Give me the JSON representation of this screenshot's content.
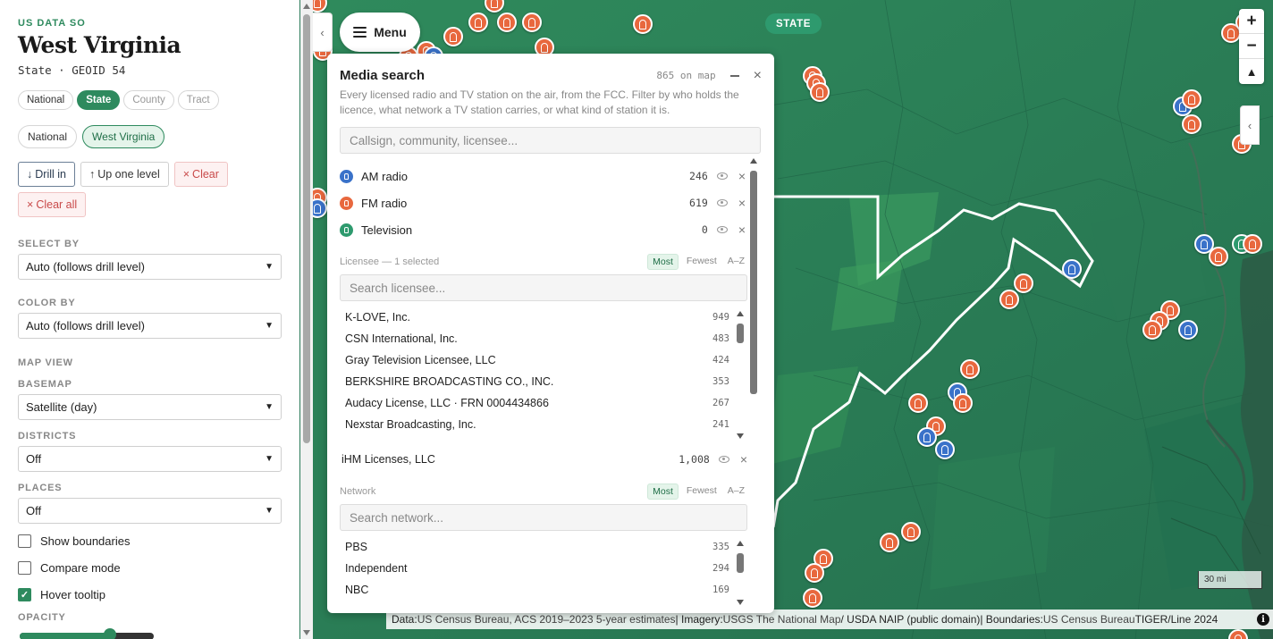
{
  "sidebar": {
    "eyebrow": "US DATA SO",
    "title": "West Virginia",
    "subtitle": "State · GEOID 54",
    "levels": [
      {
        "label": "National",
        "state": "normal"
      },
      {
        "label": "State",
        "state": "active"
      },
      {
        "label": "County",
        "state": "muted"
      },
      {
        "label": "Tract",
        "state": "muted"
      }
    ],
    "breadcrumb": [
      {
        "label": "National",
        "active": false
      },
      {
        "label": "West Virginia",
        "active": true
      }
    ],
    "actions": {
      "drill_in": "Drill in",
      "up_one_level": "Up one level",
      "clear": "Clear",
      "clear_all": "Clear all"
    },
    "select_by": {
      "label": "SELECT BY",
      "value": "Auto (follows drill level)"
    },
    "color_by": {
      "label": "COLOR BY",
      "value": "Auto (follows drill level)"
    },
    "map_view_label": "MAP VIEW",
    "basemap": {
      "label": "BASEMAP",
      "value": "Satellite (day)"
    },
    "districts": {
      "label": "DISTRICTS",
      "value": "Off"
    },
    "places": {
      "label": "PLACES",
      "value": "Off"
    },
    "checks": {
      "show_boundaries": {
        "label": "Show boundaries",
        "checked": false
      },
      "compare_mode": {
        "label": "Compare mode",
        "checked": false
      },
      "hover_tooltip": {
        "label": "Hover tooltip",
        "checked": true
      }
    },
    "opacity": {
      "label": "OPACITY",
      "value": 0.67
    }
  },
  "map": {
    "menu_label": "Menu",
    "level_badge": "STATE",
    "scale_label": "30 mi",
    "attribution": {
      "data_prefix": "Data: ",
      "data_source": "US Census Bureau, ACS 2019–2023 5-year estimates",
      "sep1": " | Imagery: ",
      "imagery_source": "USGS The National Map",
      "imagery_suffix": " / USDA NAIP (public domain)",
      "sep2": " | Boundaries: ",
      "boundaries_source": "US Census Bureau",
      "boundaries_suffix": " TIGER/Line 2024"
    },
    "colors": {
      "fm": "#e8683e",
      "am": "#3a72c9",
      "tv": "#2e9a6e",
      "state_outline": "#ffffff"
    }
  },
  "media_panel": {
    "title": "Media search",
    "count_text": "865 on map",
    "description": "Every licensed radio and TV station on the air, from the FCC. Filter by who holds the licence, what network a TV station carries, or what kind of station it is.",
    "search_placeholder": "Callsign, community, licensee...",
    "types": [
      {
        "label": "AM radio",
        "count": "246",
        "kind": "am"
      },
      {
        "label": "FM radio",
        "count": "619",
        "kind": "fm"
      },
      {
        "label": "Television",
        "count": "0",
        "kind": "tv"
      }
    ],
    "licensee": {
      "header": "Licensee — 1 selected",
      "sort": [
        "Most",
        "Fewest",
        "A–Z"
      ],
      "search_placeholder": "Search licensee...",
      "items": [
        {
          "name": "K-LOVE, Inc.",
          "count": "949"
        },
        {
          "name": "CSN International, Inc.",
          "count": "483"
        },
        {
          "name": "Gray Television Licensee, LLC",
          "count": "424"
        },
        {
          "name": "BERKSHIRE BROADCASTING CO., INC.",
          "count": "353"
        },
        {
          "name": "Audacy License, LLC · FRN 0004434866",
          "count": "267"
        },
        {
          "name": "Nexstar Broadcasting, Inc.",
          "count": "241"
        }
      ],
      "selected": {
        "name": "iHM Licenses, LLC",
        "count": "1,008"
      }
    },
    "network": {
      "header": "Network",
      "sort": [
        "Most",
        "Fewest",
        "A–Z"
      ],
      "search_placeholder": "Search network...",
      "items": [
        {
          "name": "PBS",
          "count": "335"
        },
        {
          "name": "Independent",
          "count": "294"
        },
        {
          "name": "NBC",
          "count": "169"
        }
      ]
    }
  }
}
